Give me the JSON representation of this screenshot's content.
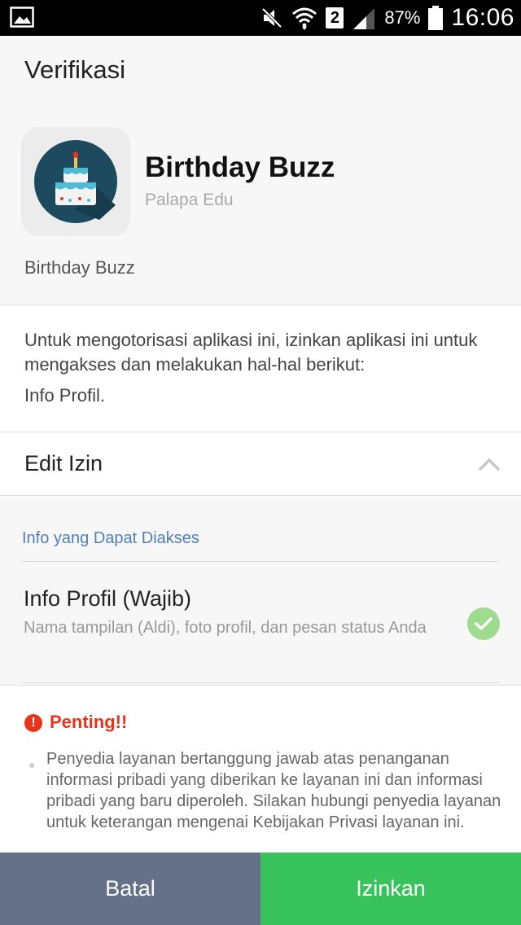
{
  "status_bar": {
    "sim_number": "2",
    "battery_percent": "87%",
    "time": "16:06",
    "icons": [
      "image-icon",
      "mute-icon",
      "wifi-icon",
      "signal-icon",
      "battery-icon"
    ]
  },
  "header": {
    "title": "Verifikasi"
  },
  "app": {
    "name": "Birthday Buzz",
    "developer": "Palapa Edu",
    "description": "Birthday Buzz",
    "icon": "birthday-cake-icon"
  },
  "authorization": {
    "text": "Untuk mengotorisasi aplikasi ini, izinkan aplikasi ini untuk mengakses dan melakukan hal-hal berikut:",
    "scope": "Info Profil."
  },
  "edit_permissions": {
    "label": "Edit Izin",
    "expanded": true
  },
  "permissions": {
    "heading": "Info yang Dapat Diakses",
    "items": [
      {
        "title": "Info Profil (Wajib)",
        "description": "Nama tampilan (Aldi), foto profil, dan pesan status Anda",
        "checked": true
      }
    ]
  },
  "notice": {
    "title": "Penting!!",
    "body": "Penyedia layanan bertanggung jawab atas penanganan informasi pribadi yang diberikan ke layanan ini dan informasi pribadi yang baru diperoleh. Silakan hubungi penyedia layanan untuk keterangan mengenai Kebijakan Privasi layanan ini."
  },
  "buttons": {
    "cancel": "Batal",
    "allow": "Izinkan"
  },
  "colors": {
    "cancel_button": "#657188",
    "allow_button": "#39c35d",
    "warning": "#e8351a",
    "link_heading": "#4f7fba",
    "check": "#9fdb8e"
  }
}
